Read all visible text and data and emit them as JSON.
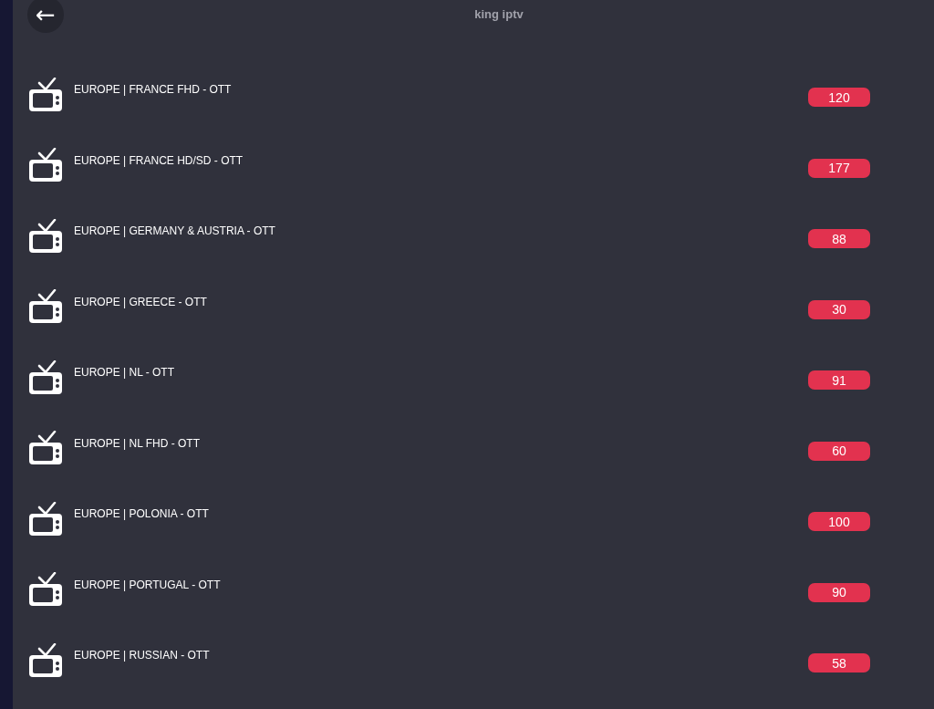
{
  "header": {
    "back": "←",
    "title": "king iptv"
  },
  "categories": [
    {
      "name": "EUROPE | FRANCE FHD - OTT",
      "count": "120"
    },
    {
      "name": "EUROPE | FRANCE HD/SD - OTT",
      "count": "177"
    },
    {
      "name": "EUROPE | GERMANY & AUSTRIA - OTT",
      "count": "88"
    },
    {
      "name": "EUROPE | GREECE - OTT",
      "count": "30"
    },
    {
      "name": "EUROPE | NL - OTT",
      "count": "91"
    },
    {
      "name": "EUROPE | NL FHD - OTT",
      "count": "60"
    },
    {
      "name": "EUROPE | POLONIA - OTT",
      "count": "100"
    },
    {
      "name": "EUROPE | PORTUGAL - OTT",
      "count": "90"
    },
    {
      "name": "EUROPE | RUSSIAN - OTT",
      "count": "58"
    }
  ]
}
